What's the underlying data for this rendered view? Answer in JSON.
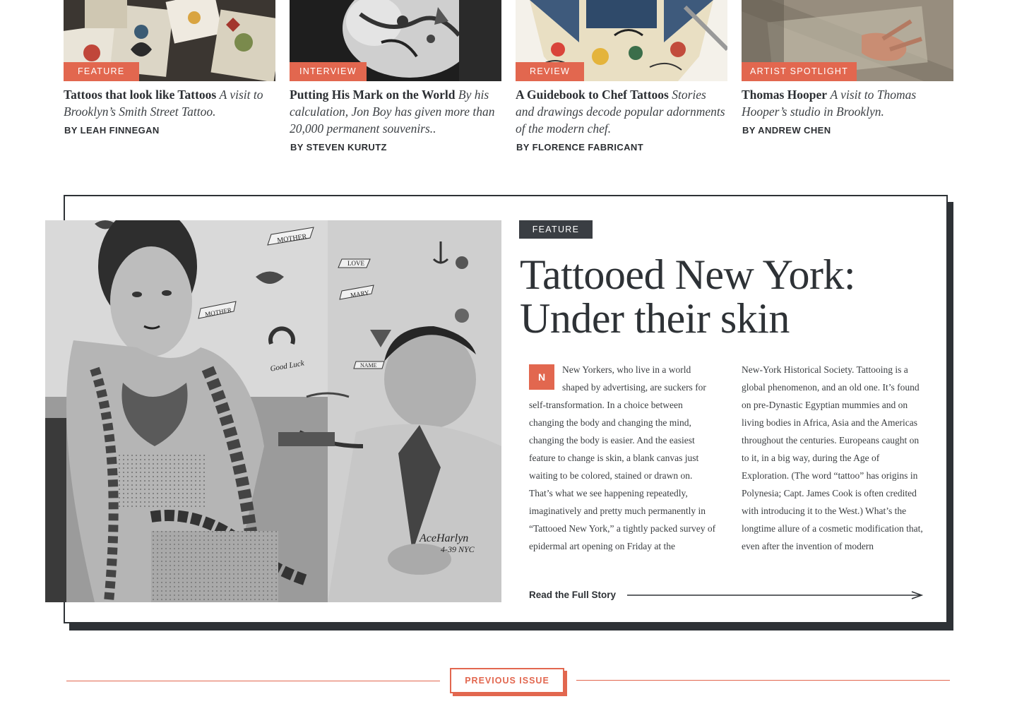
{
  "cards": [
    {
      "tag": "FEATURE",
      "title": "Tattoos that look like Tattoos",
      "subtitle": "A visit to Brooklyn’s Smith Street Tattoo.",
      "byline": "BY LEAH FINNEGAN"
    },
    {
      "tag": "INTERVIEW",
      "title": "Putting His Mark on the World",
      "subtitle": "By his calculation, Jon Boy has given more than 20,000 permanent souvenirs..",
      "byline": "BY STEVEN KURUTZ"
    },
    {
      "tag": "REVIEW",
      "title": "A Guidebook to Chef Tattoos",
      "subtitle": "Stories and drawings decode popular adornments of the modern chef.",
      "byline": "BY FLORENCE FABRICANT"
    },
    {
      "tag": "ARTIST SPOTLIGHT",
      "title": "Thomas Hooper",
      "subtitle": "A visit to Thomas Hooper’s studio in Brooklyn.",
      "byline": "BY ANDREW CHEN"
    }
  ],
  "feature": {
    "tag": "FEATURE",
    "title_line1": "Tattooed New York:",
    "title_line2": "Under their skin",
    "dropcap": "N",
    "col1": "New Yorkers, who live in a world shaped by advertising, are suckers for self-transformation. In a choice between changing the body and changing the mind, changing the body is easier. And the easiest feature to change is skin, a blank canvas just waiting to be colored, stained or drawn on. That’s what we see happening repeatedly, imaginatively and pretty much permanently in “Tattooed New York,” a tightly packed survey of epidermal art opening on Friday at the",
    "col2": "New-York Historical Society. Tattooing is a global phenomenon, and an old one. It’s found on pre-Dynastic Egyptian mummies and on living bodies in Africa, Asia and the Americas throughout the centuries. Europeans caught on to it, in a big way, during the Age of Exploration. (The word “tattoo” has origins in Polynesia; Capt. James Cook is often credited with introducing it to the West.) What’s the longtime allure of a cosmetic modification that, even after the invention of modern",
    "read_more": "Read the Full Story",
    "image_text": {
      "banner1": "MOTHER",
      "banner2": "LOVE",
      "banner3": "MARY",
      "banner4": "MOTHER",
      "banner5": "Good Luck",
      "banner6": "NAME",
      "signature": "AceHarlyn",
      "date": "4-39 NYC"
    }
  },
  "previous_issue": "PREVIOUS ISSUE",
  "colors": {
    "accent": "#e2674f",
    "dark": "#2e3236",
    "text": "#3a3d40"
  }
}
